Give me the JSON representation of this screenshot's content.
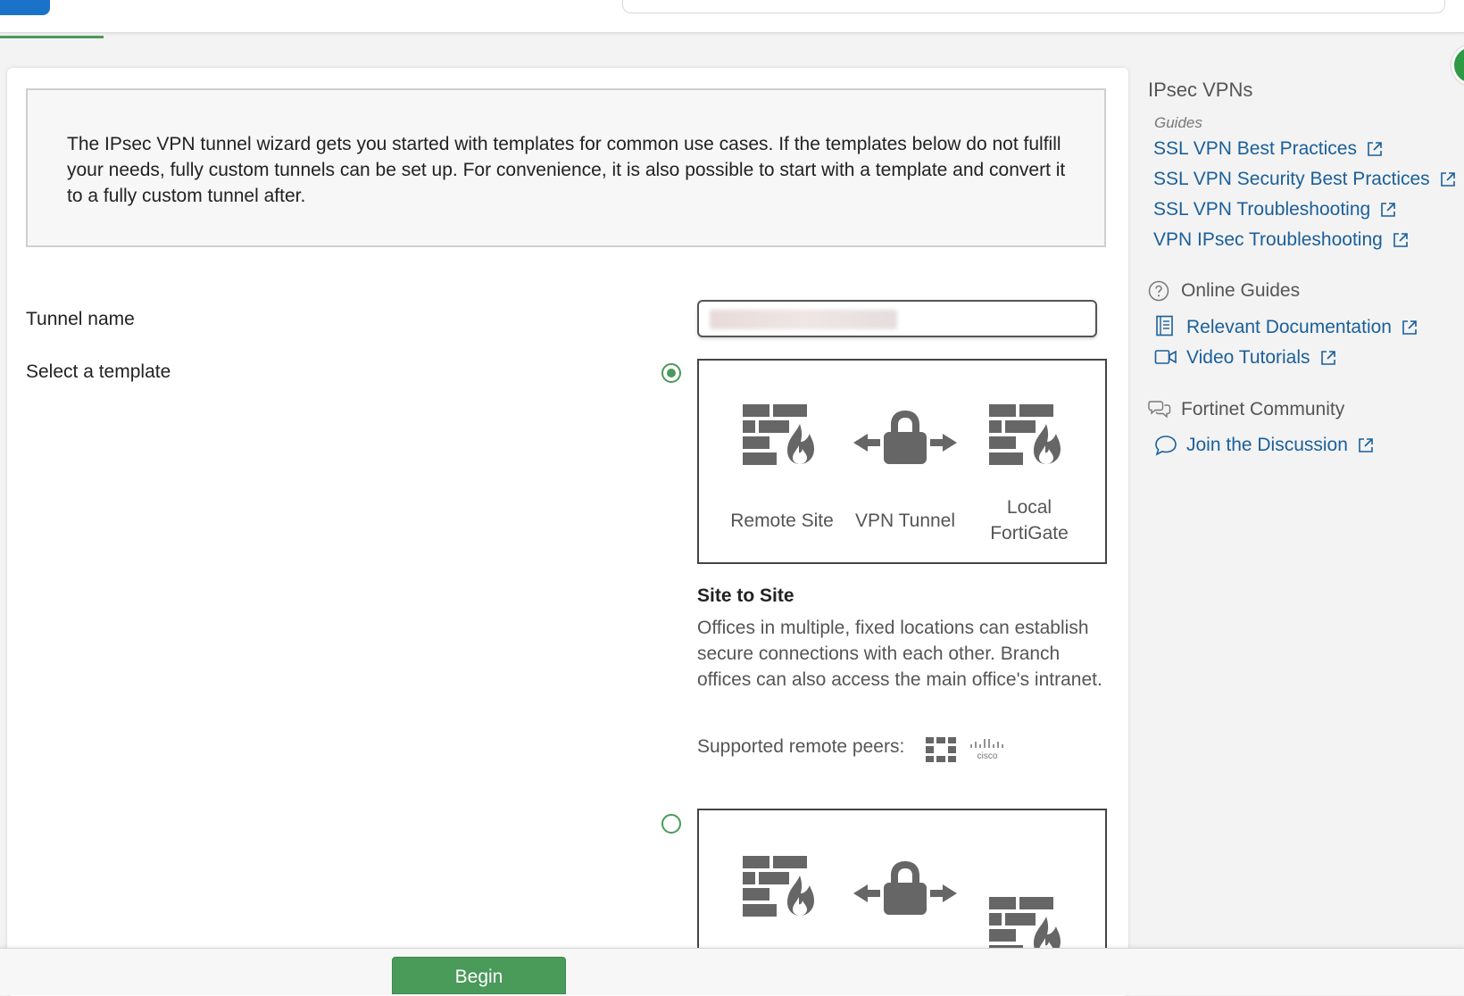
{
  "intro": {
    "text": "The IPsec VPN tunnel wizard gets you started with templates for common use cases. If the templates below do not fulfill your needs, fully custom tunnels can be set up. For convenience, it is also possible to start with a template and convert it to a fully custom tunnel after."
  },
  "form": {
    "tunnel_name_label": "Tunnel name",
    "tunnel_name_value": "",
    "select_template_label": "Select a template"
  },
  "templates": [
    {
      "selected": true,
      "captions": {
        "left": "Remote Site",
        "middle": "VPN Tunnel",
        "right_line1": "Local",
        "right_line2": "FortiGate"
      },
      "title": "Site to Site",
      "description": "Offices in multiple, fixed locations can establish secure connections with each other. Branch offices can also access the main office's intranet.",
      "peers_label": "Supported remote peers:",
      "peer_icons": [
        "fortinet-logo-icon",
        "cisco-logo-icon"
      ]
    },
    {
      "selected": false
    }
  ],
  "sidebar": {
    "heading": "IPsec VPNs",
    "guides_label": "Guides",
    "guides": [
      "SSL VPN Best Practices",
      "SSL VPN Security Best Practices",
      "SSL VPN Troubleshooting",
      "VPN IPsec Troubleshooting"
    ],
    "online_guides_heading": "Online Guides",
    "online_guides": [
      "Relevant Documentation",
      "Video Tutorials"
    ],
    "community_heading": "Fortinet Community",
    "community_link": "Join the Discussion"
  },
  "footer": {
    "begin_label": "Begin"
  },
  "colors": {
    "accent_green": "#4a9a5a",
    "link_blue": "#1a5f9a",
    "icon_gray": "#666666"
  }
}
